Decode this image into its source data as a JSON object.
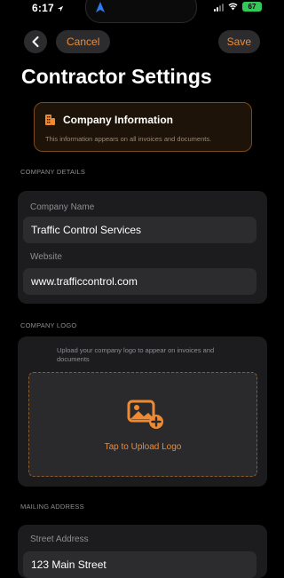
{
  "status_bar": {
    "time": "6:17",
    "battery": "67"
  },
  "nav": {
    "cancel_label": "Cancel",
    "save_label": "Save"
  },
  "page": {
    "title": "Contractor Settings"
  },
  "info_banner": {
    "title": "Company Information",
    "description": "This information appears on all invoices and documents."
  },
  "company_details": {
    "section_label": "COMPANY DETAILS",
    "name_label": "Company Name",
    "name_value": "Traffic Control Services",
    "website_label": "Website",
    "website_value": "www.trafficcontrol.com"
  },
  "company_logo": {
    "section_label": "COMPANY LOGO",
    "description": "Upload your company logo to appear on invoices and documents",
    "upload_label": "Tap to Upload Logo"
  },
  "mailing_address": {
    "section_label": "MAILING ADDRESS",
    "street_label": "Street Address",
    "street_value": "123 Main Street"
  },
  "colors": {
    "accent": "#f08a32",
    "background": "#000000",
    "card": "#1c1c1e",
    "field": "#2c2c2e"
  },
  "icons": [
    "location-arrow-icon",
    "signal-icon",
    "wifi-icon",
    "battery-icon",
    "chevron-left-icon",
    "building-icon",
    "image-add-icon"
  ]
}
